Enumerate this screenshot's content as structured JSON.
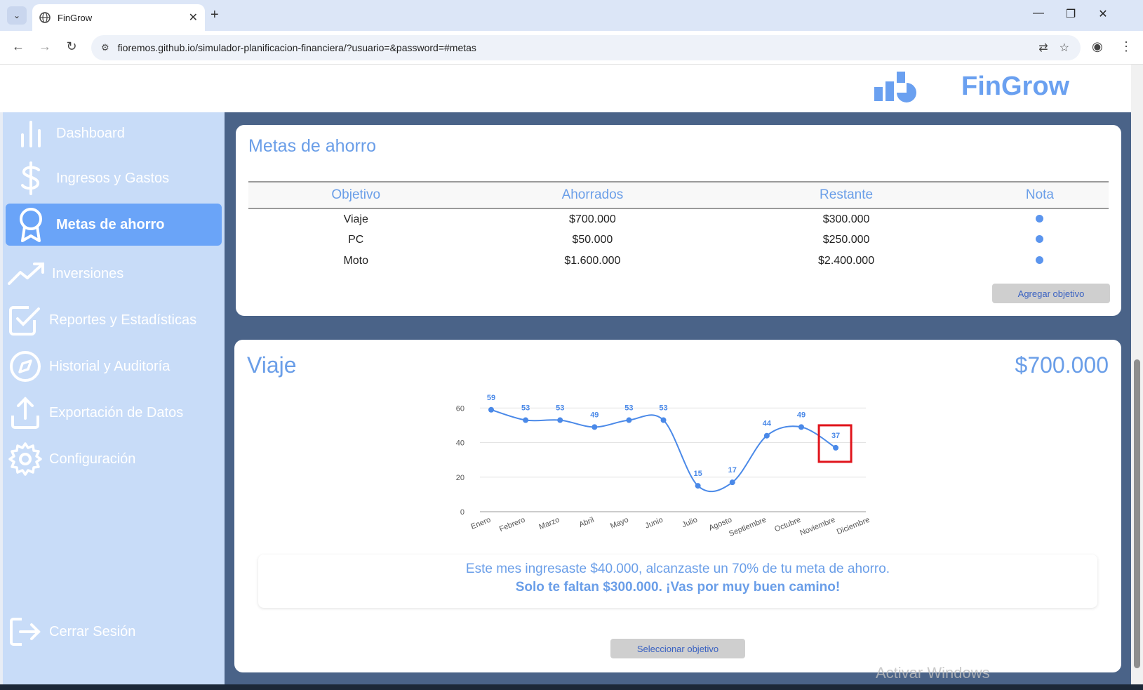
{
  "browser": {
    "tab_title": "FinGrow",
    "url": "fioremos.github.io/simulador-planificacion-financiera/?usuario=&password=#metas"
  },
  "app": {
    "brand": "FinGrow",
    "brand_color": "#6aa0f0"
  },
  "sidebar": {
    "items": [
      {
        "label": "Dashboard",
        "icon": "bar-chart-icon"
      },
      {
        "label": "Ingresos y Gastos",
        "icon": "dollar-icon"
      },
      {
        "label": "Metas de ahorro",
        "icon": "award-icon",
        "active": true
      },
      {
        "label": "Inversiones",
        "icon": "trending-up-icon"
      },
      {
        "label": "Reportes y Estadísticas",
        "icon": "check-square-icon"
      },
      {
        "label": "Historial y Auditoría",
        "icon": "compass-icon"
      },
      {
        "label": "Exportación de Datos",
        "icon": "upload-icon"
      },
      {
        "label": "Configuración",
        "icon": "gear-icon"
      }
    ],
    "logout": "Cerrar Sesión"
  },
  "goals": {
    "title": "Metas de ahorro",
    "columns": [
      "Objetivo",
      "Ahorrados",
      "Restante",
      "Nota"
    ],
    "rows": [
      {
        "objetivo": "Viaje",
        "ahorrados": "$700.000",
        "restante": "$300.000"
      },
      {
        "objetivo": "PC",
        "ahorrados": "$50.000",
        "restante": "$250.000"
      },
      {
        "objetivo": "Moto",
        "ahorrados": "$1.600.000",
        "restante": "$2.400.000"
      }
    ],
    "add_button": "Agregar objetivo"
  },
  "detail": {
    "title": "Viaje",
    "amount": "$700.000",
    "summary_line1": "Este mes ingresaste $40.000, alcanzaste un 70% de tu meta de ahorro.",
    "summary_line2": "Solo te faltan $300.000. ¡Vas por muy buen camino!",
    "select_button": "Seleccionar objetivo"
  },
  "chart_data": {
    "type": "line",
    "categories": [
      "Enero",
      "Febrero",
      "Marzo",
      "Abril",
      "Mayo",
      "Junio",
      "Julio",
      "Agosto",
      "Septiembre",
      "Octubre",
      "Noviembre",
      "Diciembre"
    ],
    "values": [
      59,
      53,
      53,
      49,
      53,
      53,
      15,
      17,
      44,
      49,
      37,
      null
    ],
    "yticks": [
      0,
      20,
      40,
      60
    ],
    "ylim": [
      0,
      65
    ],
    "grid": true,
    "highlighted_index": 10,
    "line_color": "#4a89e8",
    "highlight_color": "#e0141b"
  },
  "watermark": "Activar Windows"
}
